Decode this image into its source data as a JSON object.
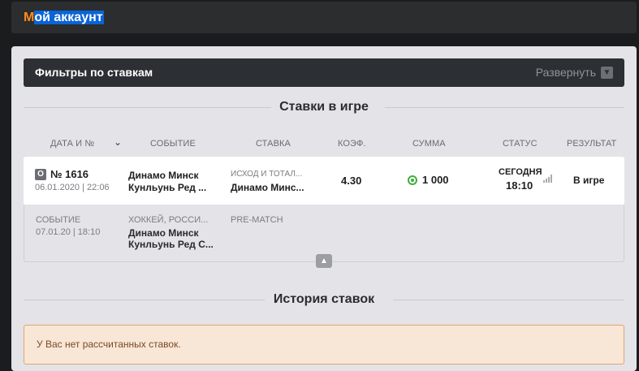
{
  "header": {
    "title_first": "М",
    "title_rest": "ой аккаунт"
  },
  "filters": {
    "title": "Фильтры по ставкам",
    "expand_label": "Развернуть",
    "expand_icon": "chevron-down-icon"
  },
  "active_bets": {
    "title": "Ставки в игре",
    "columns": [
      "ДАТА и №",
      "СОБЫТИЕ",
      "СТАВКА",
      "КОЭФ.",
      "СУММА",
      "СТАТУС",
      "РЕЗУЛЬТАТ"
    ],
    "sort_icon": "chevron-down-icon",
    "rows": [
      {
        "badge": "О",
        "number": "№ 1616",
        "date": "06.01.2020 | 22:06",
        "event_line1": "Динамо Минск",
        "event_line2": "Кунльунь Ред ...",
        "bet_type": "ИСХОД И ТОТАЛ...",
        "bet_pick": "Динамо Минс...",
        "coef": "4.30",
        "sum": "1 000",
        "status_day": "СЕГОДНЯ",
        "status_time": "18:10",
        "result": "В игре",
        "detail": {
          "label": "СОБЫТИЕ",
          "date": "07.01.20 | 18:10",
          "category": "ХОККЕЙ, РОССИ...",
          "event_line1": "Динамо Минск",
          "event_line2": "Кунльунь Ред С...",
          "market": "PRE-MATCH"
        }
      }
    ]
  },
  "history": {
    "title": "История ставок",
    "empty_notice": "У Вас нет рассчитанных ставок."
  },
  "colors": {
    "accent": "#ff8c1a",
    "selection": "#0a64d6",
    "coin": "#3fae3a",
    "notice_border": "#e2a66a"
  }
}
